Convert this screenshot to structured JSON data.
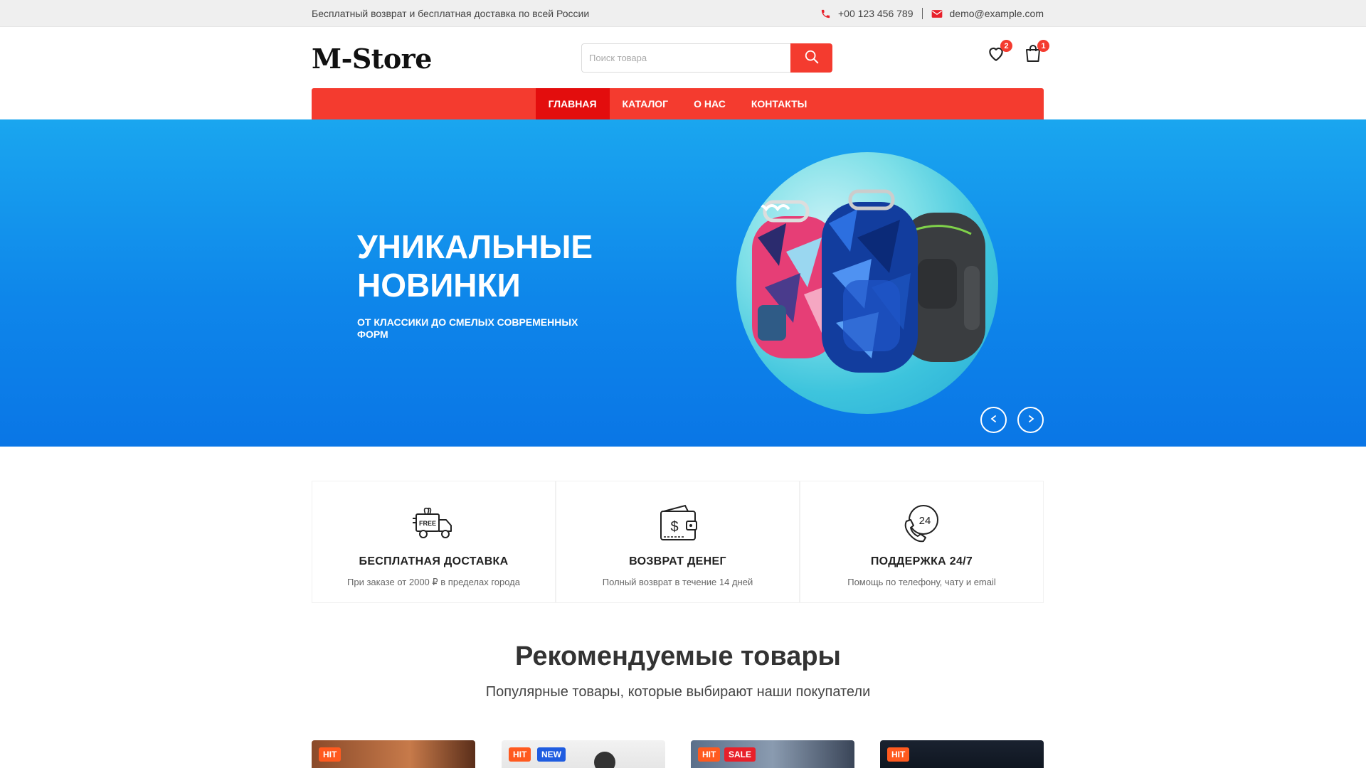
{
  "topbar": {
    "promo": "Бесплатный возврат и бесплатная доставка по всей России",
    "phone": "+00 123 456 789",
    "email": "demo@example.com"
  },
  "header": {
    "logo": "M-Store",
    "search_placeholder": "Поиск товара",
    "wishlist_count": "2",
    "cart_count": "1"
  },
  "nav": {
    "items": [
      {
        "label": "ГЛАВНАЯ",
        "active": true
      },
      {
        "label": "КАТАЛОГ",
        "active": false
      },
      {
        "label": "О НАС",
        "active": false
      },
      {
        "label": "КОНТАКТЫ",
        "active": false
      }
    ]
  },
  "hero": {
    "title_line1": "УНИКАЛЬНЫЕ",
    "title_line2": "НОВИНКИ",
    "subtitle": "ОТ КЛАССИКИ ДО СМЕЛЫХ СОВРЕМЕННЫХ ФОРМ"
  },
  "features": [
    {
      "icon": "free-delivery-truck-icon",
      "title": "БЕСПЛАТНАЯ ДОСТАВКА",
      "desc": "При заказе от 2000 ₽ в пределах города"
    },
    {
      "icon": "money-back-wallet-icon",
      "title": "ВОЗВРАТ ДЕНЕГ",
      "desc": "Полный возврат в течение 14 дней"
    },
    {
      "icon": "support-24-phone-icon",
      "title": "ПОДДЕРЖКА 24/7",
      "desc": "Помощь по телефону, чату и email"
    }
  ],
  "featured": {
    "title": "Рекомендуемые товары",
    "subtitle": "Популярные товары, которые выбирают наши покупатели"
  },
  "products": [
    {
      "tags": [
        "HIT"
      ]
    },
    {
      "tags": [
        "HIT",
        "NEW"
      ]
    },
    {
      "tags": [
        "HIT",
        "SALE"
      ]
    },
    {
      "tags": [
        "HIT"
      ]
    }
  ],
  "colors": {
    "accent": "#f43b2f",
    "nav_active": "#e30d0d",
    "hero_blue": "#0e86ea",
    "tag_hit": "#ff5a1f",
    "tag_new": "#1f5ce0",
    "tag_sale": "#e8202a"
  }
}
